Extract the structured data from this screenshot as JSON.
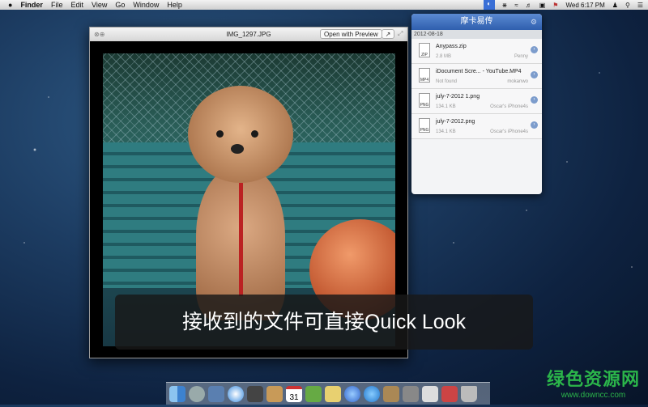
{
  "menubar": {
    "app": "Finder",
    "items": [
      "File",
      "Edit",
      "View",
      "Go",
      "Window",
      "Help"
    ],
    "clock": "Wed 6:17 PM"
  },
  "quicklook": {
    "title": "IMG_1297.JPG",
    "open_button": "Open with Preview",
    "share_icon": "share-icon",
    "fullscreen_icon": "expand-icon"
  },
  "caption": "接收到的文件可直接Quick Look",
  "panel": {
    "title": "摩卡易传",
    "date": "2012-08-18",
    "files": [
      {
        "name": "Anypass.zip",
        "size": "2.8 MB",
        "device": "Penny",
        "type": "ZIP"
      },
      {
        "name": "iDocument Scre... - YouTube.MP4",
        "size": "Not found",
        "device": "mokanwo",
        "type": "MP4"
      },
      {
        "name": "july-7-2012 1.png",
        "size": "134.1 KB",
        "device": "Oscar's iPhone4s",
        "type": "PNG"
      },
      {
        "name": "july-7-2012.png",
        "size": "134.1 KB",
        "device": "Oscar's iPhone4s",
        "type": "PNG"
      }
    ]
  },
  "dock": {
    "calendar_day": "31"
  },
  "watermark": {
    "name": "绿色资源网",
    "url": "www.downcc.com"
  },
  "colors": {
    "panel_header": "#3f6fbf",
    "watermark": "#2bb54a"
  }
}
